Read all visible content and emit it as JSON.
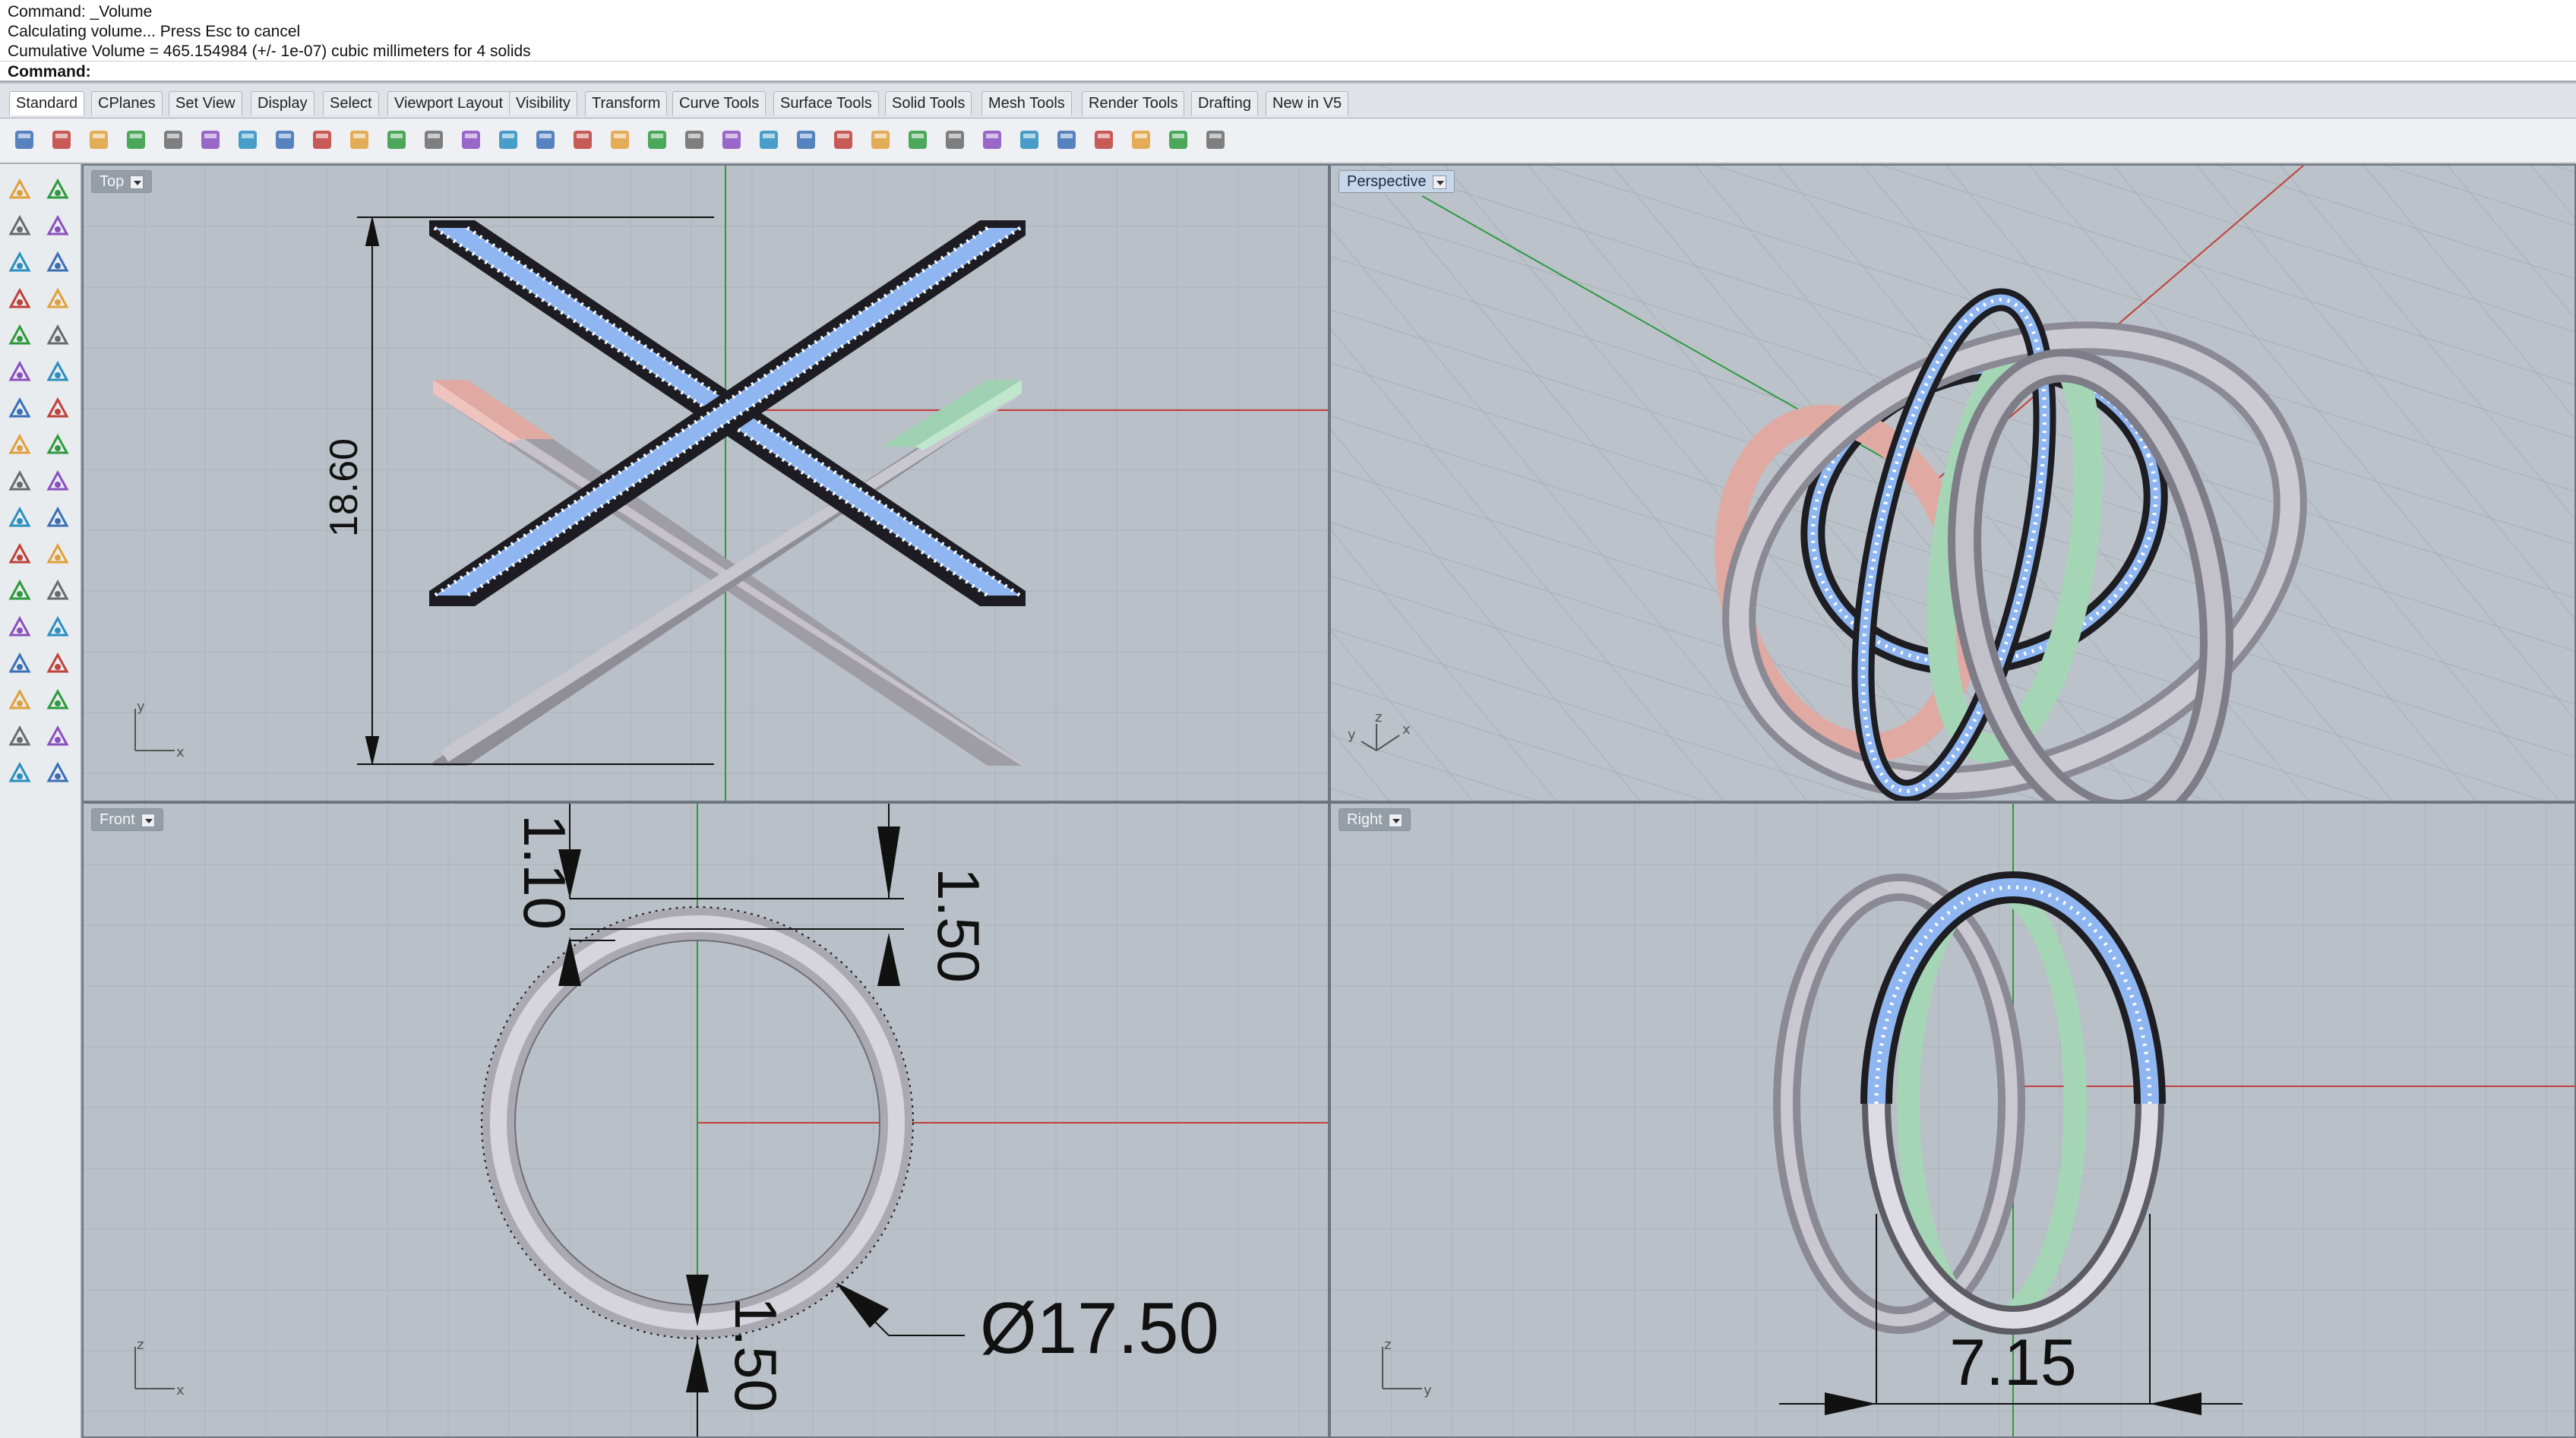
{
  "command_history": [
    "Command: _Volume",
    "Calculating volume... Press Esc to cancel",
    "Cumulative Volume = 465.154984 (+/- 1e-07) cubic millimeters for 4 solids"
  ],
  "command_prompt": "Command:",
  "tabs": [
    {
      "label": "Standard",
      "active": true
    },
    {
      "label": "CPlanes"
    },
    {
      "label": "Set View"
    },
    {
      "label": "Display"
    },
    {
      "label": "Select"
    },
    {
      "label": "Viewport Layout"
    },
    {
      "label": "Visibility"
    },
    {
      "label": "Transform"
    },
    {
      "label": "Curve Tools"
    },
    {
      "label": "Surface Tools"
    },
    {
      "label": "Solid Tools"
    },
    {
      "label": "Mesh Tools"
    },
    {
      "label": "Render Tools"
    },
    {
      "label": "Drafting"
    },
    {
      "label": "New in V5"
    }
  ],
  "toolbar_icons": [
    "new-file-icon",
    "open-file-icon",
    "save-icon",
    "print-icon",
    "import-icon",
    "cut-icon",
    "copy-icon",
    "paste-icon",
    "undo-icon",
    "pan-hand-icon",
    "rotate-view-icon",
    "zoom-icon",
    "zoom-window-icon",
    "zoom-extents-icon",
    "zoom-selected-icon",
    "rotate-icon",
    "grid-icon",
    "object-snap-icon",
    "hide-icon",
    "show-icon",
    "cplane-icon",
    "light-icon",
    "lock-icon",
    "layer-icon",
    "color-wheel-icon",
    "shaded-sphere-icon",
    "rendered-sphere-icon",
    "render-sphere-icon",
    "blue-sphere-icon",
    "material-icon",
    "options-gear-icon",
    "dimension-icon",
    "help-icon"
  ],
  "left_tools": [
    "select-arrow-icon",
    "point-icon",
    "polyline-icon",
    "curve-icon",
    "circle-icon",
    "ellipse-icon",
    "polygon-icon",
    "rectangle-icon",
    "arc-icon",
    "fillet-curve-icon",
    "freeform-icon",
    "extrude-icon",
    "box-solid-icon",
    "sphere-solid-icon",
    "cylinder-icon",
    "surface-icon",
    "explode-icon",
    "boolean-icon",
    "split-icon",
    "trim-icon",
    "blend-icon",
    "offset-icon",
    "text-icon",
    "scale-icon",
    "array-icon",
    "move-icon",
    "polar-array-icon",
    "align-icon",
    "mesh-icon",
    "analyze-icon",
    "edit-icon",
    "check-icon",
    "render-icon",
    "light-paint-icon"
  ],
  "colors": {
    "viewport_bg": "#b9c0c7",
    "grid_minor": "#a9b0b8",
    "grid_major": "#9ca3ab",
    "x_axis": "#c0403a",
    "y_axis": "#2e9a3e",
    "band_blue": "#8fb6f0",
    "band_gray": "#c4c2cc",
    "band_pink": "#e2a9a2",
    "band_green": "#a4d6b6"
  },
  "viewports": {
    "top": {
      "label": "Top",
      "dimension": "18.60",
      "axis_y": "y",
      "axis_x": "x"
    },
    "perspective": {
      "label": "Perspective",
      "axis_y": "y",
      "axis_z": "z",
      "axis_x": "x"
    },
    "front": {
      "label": "Front",
      "dim_top_left": "1.10",
      "dim_top_right": "1.50",
      "dim_bottom": "1.50",
      "diameter": "Ø17.50",
      "axis_z": "z",
      "axis_x": "x"
    },
    "right": {
      "label": "Right",
      "dimension": "7.15",
      "axis_z": "z",
      "axis_y": "y"
    }
  }
}
